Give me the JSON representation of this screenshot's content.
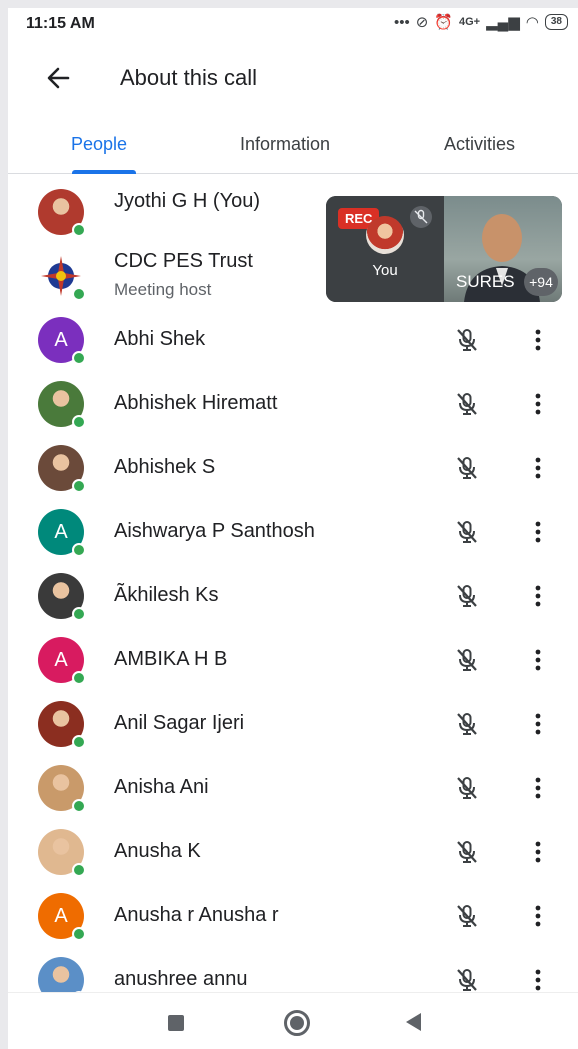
{
  "status": {
    "time": "11:15 AM",
    "network": "4G+",
    "battery": "38"
  },
  "header": {
    "title": "About this call"
  },
  "tabs": [
    {
      "label": "People",
      "active": true
    },
    {
      "label": "Information",
      "active": false
    },
    {
      "label": "Activities",
      "active": false
    }
  ],
  "self_view": {
    "rec_label": "REC",
    "you_label": "You",
    "pinned_name": "SURES",
    "more_count": "+94"
  },
  "participants": [
    {
      "name": "Jyothi G H (You)",
      "subtitle": "",
      "avatar": "photo",
      "color": "#b03a2e",
      "icon": "person-photo"
    },
    {
      "name": "CDC PES Trust",
      "subtitle": "Meeting host",
      "avatar": "logo",
      "color": "#c0392b",
      "icon": "compass-logo"
    },
    {
      "name": "Abhi Shek",
      "avatar": "letter",
      "letter": "A",
      "color": "#7b2fbe"
    },
    {
      "name": "Abhishek Hirematt",
      "avatar": "photo",
      "color": "#4a7a3b"
    },
    {
      "name": "Abhishek S",
      "avatar": "photo",
      "color": "#6b4a3a"
    },
    {
      "name": "Aishwarya P Santhosh",
      "avatar": "letter",
      "letter": "A",
      "color": "#00897b"
    },
    {
      "name": "Ãkhilesh Ks",
      "avatar": "photo",
      "color": "#3a3a3a"
    },
    {
      "name": "AMBIKA H B",
      "avatar": "letter",
      "letter": "A",
      "color": "#d81b60"
    },
    {
      "name": "Anil Sagar Ijeri",
      "avatar": "photo",
      "color": "#8b2e20"
    },
    {
      "name": "Anisha Ani",
      "avatar": "photo",
      "color": "#c99a6a"
    },
    {
      "name": "Anusha K",
      "avatar": "photo",
      "color": "#e0b890"
    },
    {
      "name": "Anusha r Anusha r",
      "avatar": "letter",
      "letter": "A",
      "color": "#ef6c00"
    },
    {
      "name": "anushree annu",
      "avatar": "photo",
      "color": "#5b8fc7"
    }
  ],
  "colors": {
    "accent": "#1a73e8",
    "online": "#34a853",
    "rec": "#d93025"
  }
}
